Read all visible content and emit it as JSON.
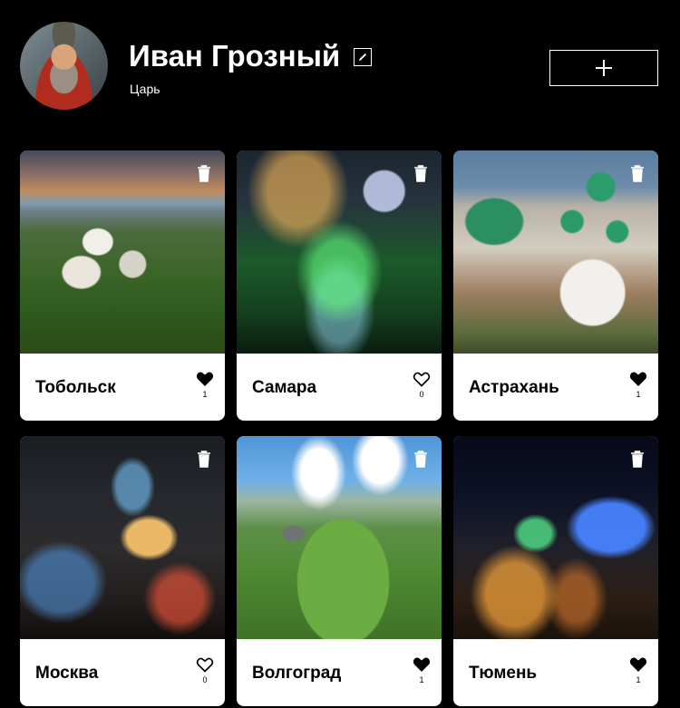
{
  "profile": {
    "name": "Иван Грозный",
    "title": "Царь",
    "avatar_icon": "user-avatar-photo",
    "edit_icon": "pencil-icon",
    "add_icon": "plus-icon"
  },
  "cards": [
    {
      "title": "Тобольск",
      "likes": "1",
      "liked": true
    },
    {
      "title": "Самара",
      "likes": "0",
      "liked": false
    },
    {
      "title": "Астрахань",
      "likes": "1",
      "liked": true
    },
    {
      "title": "Москва",
      "likes": "0",
      "liked": false
    },
    {
      "title": "Волгоград",
      "likes": "1",
      "liked": true
    },
    {
      "title": "Тюмень",
      "likes": "1",
      "liked": true
    }
  ],
  "icons": {
    "delete": "trash-icon",
    "like": "heart-icon"
  },
  "colors": {
    "background": "#000000",
    "card": "#ffffff",
    "text_dark": "#000000",
    "text_light": "#ffffff"
  }
}
